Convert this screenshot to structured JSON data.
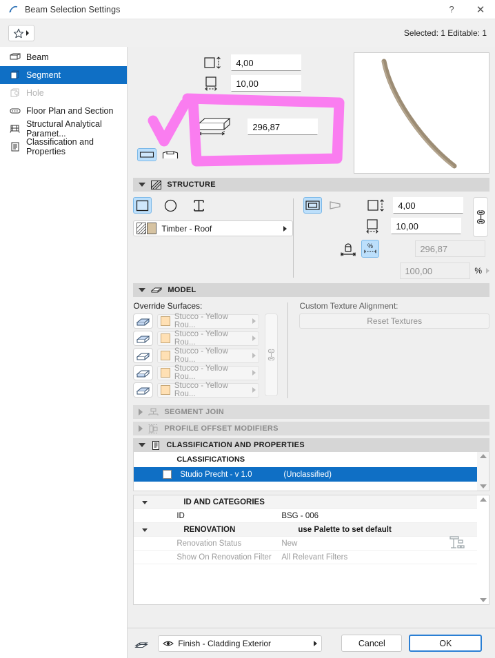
{
  "window": {
    "title": "Beam Selection Settings",
    "app_icon": "archicad-icon",
    "help_label": "?",
    "close_label": "✕"
  },
  "toolbar": {
    "favorites_label": "favorites-star",
    "selection_status": "Selected: 1 Editable: 1"
  },
  "sidebar": {
    "items": [
      {
        "label": "Beam",
        "icon": "beam-icon",
        "state": "normal"
      },
      {
        "label": "Segment",
        "icon": "segment-icon",
        "state": "active"
      },
      {
        "label": "Hole",
        "icon": "hole-icon",
        "state": "disabled"
      },
      {
        "label": "Floor Plan and Section",
        "icon": "floorplan-icon",
        "state": "normal"
      },
      {
        "label": "Structural Analytical Paramet...",
        "icon": "structural-icon",
        "state": "normal"
      },
      {
        "label": "Classification and Properties",
        "icon": "classification-icon",
        "state": "normal"
      }
    ]
  },
  "geometry": {
    "height_value": "4,00",
    "height_icon": "height-dimension-icon",
    "width_value": "10,00",
    "width_icon": "width-dimension-icon",
    "link_icon": "chain-link-icon",
    "length_value": "296,87",
    "length_icon": "beam-length-icon",
    "view_toggles": [
      {
        "icon": "straight-beam-icon",
        "active": true
      },
      {
        "icon": "curved-beam-icon",
        "active": false
      }
    ]
  },
  "preview": {
    "name": "3d-beam-preview",
    "beam_color": "#9c8c74"
  },
  "structure": {
    "header": "STRUCTURE",
    "header_icon": "hatch-icon",
    "shape_buttons": [
      {
        "icon": "rectangle-profile-icon",
        "active": true
      },
      {
        "icon": "circle-profile-icon",
        "active": false
      },
      {
        "icon": "ibeam-profile-icon",
        "active": false
      }
    ],
    "material": "Timber - Roof",
    "material_icon": "material-hatch-icon",
    "right_toggles": [
      {
        "icon": "solid-segment-icon",
        "active": true
      },
      {
        "icon": "tapered-segment-icon",
        "active": false
      }
    ],
    "height_value": "4,00",
    "width_value": "10,00",
    "link_icon": "chain-link-icon",
    "lock_icon": "locked-length-icon",
    "percent_icon": "percent-length-icon",
    "length_value": "296,87",
    "percent_value": "100,00",
    "percent_unit": "%"
  },
  "model": {
    "header": "MODEL",
    "header_icon": "box-icon",
    "override_label": "Override Surfaces:",
    "surfaces": [
      {
        "icon": "surface-all-icon",
        "name": "Stucco - Yellow Rou..."
      },
      {
        "icon": "surface-top-icon",
        "name": "Stucco - Yellow Rou..."
      },
      {
        "icon": "surface-bottom-icon",
        "name": "Stucco - Yellow Rou..."
      },
      {
        "icon": "surface-side-left-icon",
        "name": "Stucco - Yellow Rou..."
      },
      {
        "icon": "surface-side-right-icon",
        "name": "Stucco - Yellow Rou..."
      }
    ],
    "link_icon": "chain-link-icon",
    "texture_label": "Custom Texture Alignment:",
    "reset_button": "Reset Textures"
  },
  "collapsed_sections": [
    {
      "header": "SEGMENT JOIN",
      "icon": "segment-join-icon"
    },
    {
      "header": "PROFILE OFFSET MODIFIERS",
      "icon": "profile-offset-icon"
    }
  ],
  "classification": {
    "header": "CLASSIFICATION AND PROPERTIES",
    "header_icon": "classification-icon",
    "classifications_label": "CLASSIFICATIONS",
    "rows": [
      {
        "name": "Studio Precht - v 1.0",
        "value": "(Unclassified)",
        "selected": true
      }
    ],
    "id_categories_label": "ID AND CATEGORIES",
    "properties": [
      {
        "key": "ID",
        "value": "BSG - 006",
        "type": "normal"
      },
      {
        "key": "RENOVATION",
        "value": "use Palette to set default",
        "type": "group"
      },
      {
        "key": "Renovation Status",
        "value": "New",
        "type": "muted"
      },
      {
        "key": "Show On Renovation Filter",
        "value": "All Relevant Filters",
        "type": "muted"
      }
    ],
    "renovation_icon": "renovation-palette-icon"
  },
  "footer": {
    "layers_icon": "layers-stack-icon",
    "eye_icon": "eye-icon",
    "layer_name": "Finish - Cladding Exterior",
    "cancel_label": "Cancel",
    "ok_label": "OK"
  },
  "annotation": {
    "color": "#fa7df0",
    "marks": [
      "checkmark",
      "rectangle-highlight"
    ]
  },
  "colors": {
    "accent_blue": "#0f6fc5",
    "highlight_blue": "#bcdffb",
    "panel_gray": "#efefef",
    "header_gray": "#d6d6d6"
  }
}
